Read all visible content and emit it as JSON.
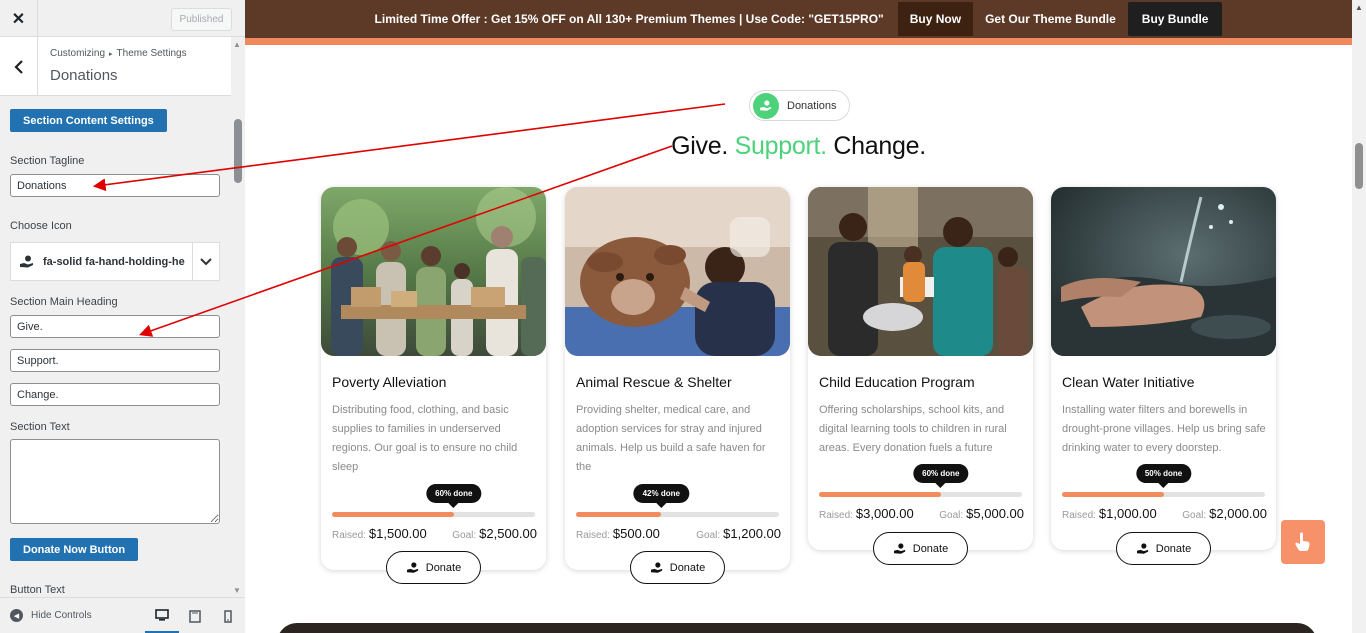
{
  "sidebar": {
    "close_label": "✕",
    "published_label": "Published",
    "breadcrumb": {
      "part1": "Customizing",
      "sep": "▸",
      "part2": "Theme Settings"
    },
    "title": "Donations",
    "section_content_button": "Section Content Settings",
    "tagline_label": "Section Tagline",
    "tagline_value": "Donations",
    "icon_label": "Choose Icon",
    "icon_value": "fa-solid fa-hand-holding-he",
    "main_heading_label": "Section Main Heading",
    "heading_values": [
      "Give.",
      "Support.",
      "Change."
    ],
    "section_text_label": "Section Text",
    "section_text_value": "",
    "donate_now_button": "Donate Now Button",
    "button_text_label": "Button Text",
    "hide_controls_label": "Hide Controls",
    "devices": [
      "desktop",
      "tablet",
      "mobile"
    ]
  },
  "promo": {
    "text": "Limited Time Offer : Get 15% OFF on All 130+ Premium Themes | Use Code: \"GET15PRO\"",
    "buy_now": "Buy Now",
    "bundle_text": "Get Our Theme Bundle",
    "buy_bundle": "Buy Bundle",
    "bar_color": "#5d3a27",
    "accent_color": "#f08a5d"
  },
  "section": {
    "tagline": "Donations",
    "heading": {
      "part1": "Give.",
      "part2": "Support.",
      "part3": "Change."
    },
    "accent_color": "#4cd27a"
  },
  "cards": [
    {
      "title": "Poverty Alleviation",
      "description": "Distributing food, clothing, and basic supplies to families in underserved regions. Our goal is to ensure no child sleep",
      "progress_label": "60% done",
      "progress": 0.6,
      "raised_label": "Raised:",
      "raised": "$1,500.00",
      "goal_label": "Goal:",
      "goal": "$2,500.00",
      "donate_label": "Donate",
      "image_icon": "volunteers-food-photo"
    },
    {
      "title": "Animal Rescue & Shelter",
      "description": "Providing shelter, medical care, and adoption services for stray and injured animals. Help us build a safe haven for the",
      "progress_label": "42% done",
      "progress": 0.42,
      "raised_label": "Raised:",
      "raised": "$500.00",
      "goal_label": "Goal:",
      "goal": "$1,200.00",
      "donate_label": "Donate",
      "image_icon": "calf-and-child-photo"
    },
    {
      "title": "Child Education Program",
      "description": "Offering scholarships, school kits, and digital learning tools to children in rural areas. Every donation fuels a future",
      "progress_label": "60% done",
      "progress": 0.6,
      "raised_label": "Raised:",
      "raised": "$3,000.00",
      "goal_label": "Goal:",
      "goal": "$5,000.00",
      "donate_label": "Donate",
      "image_icon": "aid-distribution-photo"
    },
    {
      "title": "Clean Water Initiative",
      "description": "Installing water filters and borewells in drought-prone villages. Help us bring safe drinking water to every doorstep.",
      "progress_label": "50% done",
      "progress": 0.5,
      "raised_label": "Raised:",
      "raised": "$1,000.00",
      "goal_label": "Goal:",
      "goal": "$2,000.00",
      "donate_label": "Donate",
      "image_icon": "water-hands-photo"
    }
  ]
}
